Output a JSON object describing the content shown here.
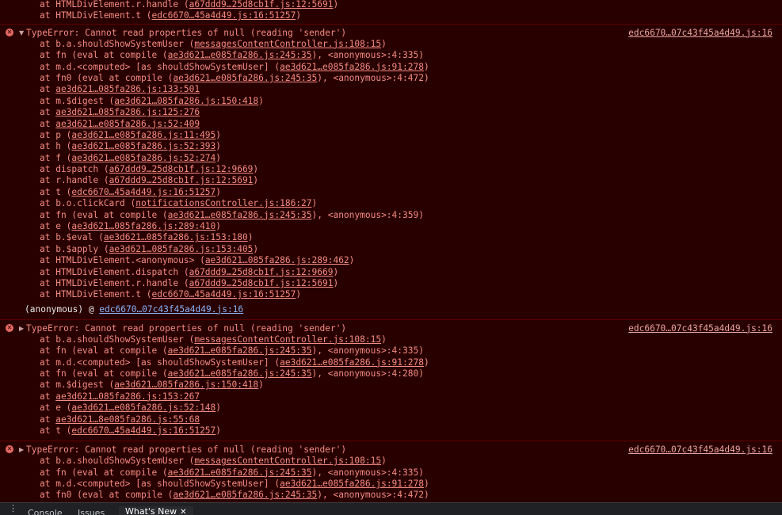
{
  "groups": [
    {
      "partial": true,
      "frames": [
        {
          "pre": "at HTMLDivElement.r.handle (",
          "loc": "a67ddd9…25d8cb1f.js:12:5691",
          "post": ")"
        },
        {
          "pre": "at HTMLDivElement.t (",
          "loc": "edc6670…45a4d49.js:16:51257",
          "post": ")"
        }
      ]
    },
    {
      "icon": "✕",
      "expanded": true,
      "toggle": "▼",
      "message": "TypeError: Cannot read properties of null (reading 'sender')",
      "source": "edc6670…07c43f45a4d49.js:16",
      "frames": [
        {
          "pre": "at b.a.shouldShowSystemUser (",
          "loc": "messagesContentController.js:108:15",
          "post": ")"
        },
        {
          "pre": "at fn (eval at compile (",
          "loc": "ae3d621…e085fa286.js:245:35",
          "post": "), <anonymous>:4:335)"
        },
        {
          "pre": "at m.d.<computed> [as shouldShowSystemUser] (",
          "loc": "ae3d621…e085fa286.js:91:278",
          "post": ")"
        },
        {
          "pre": "at fn0 (eval at compile (",
          "loc": "ae3d621…e085fa286.js:245:35",
          "post": "), <anonymous>:4:472)"
        },
        {
          "pre": "at ",
          "loc": "ae3d621…085fa286.js:133:501",
          "post": ""
        },
        {
          "pre": "at m.$digest (",
          "loc": "ae3d621…085fa286.js:150:418",
          "post": ")"
        },
        {
          "pre": "at ",
          "loc": "ae3d621…085fa286.js:125:276",
          "post": ""
        },
        {
          "pre": "at ",
          "loc": "ae3d621…e085fa286.js:52:409",
          "post": ""
        },
        {
          "pre": "at p (",
          "loc": "ae3d621…e085fa286.js:11:495",
          "post": ")"
        },
        {
          "pre": "at h (",
          "loc": "ae3d621…e085fa286.js:52:393",
          "post": ")"
        },
        {
          "pre": "at f (",
          "loc": "ae3d621…e085fa286.js:52:274",
          "post": ")"
        },
        {
          "pre": "at dispatch (",
          "loc": "a67ddd9…25d8cb1f.js:12:9669",
          "post": ")"
        },
        {
          "pre": "at r.handle (",
          "loc": "a67ddd9…25d8cb1f.js:12:5691",
          "post": ")"
        },
        {
          "pre": "at t (",
          "loc": "edc6670…45a4d49.js:16:51257",
          "post": ")"
        },
        {
          "pre": "at b.o.clickCard (",
          "loc": "notificationsController.js:186:27",
          "post": ")"
        },
        {
          "pre": "at fn (eval at compile (",
          "loc": "ae3d621…e085fa286.js:245:35",
          "post": "), <anonymous>:4:359)"
        },
        {
          "pre": "at e (",
          "loc": "ae3d621…085fa286.js:289:410",
          "post": ")"
        },
        {
          "pre": "at b.$eval (",
          "loc": "ae3d621…085fa286.js:153:180",
          "post": ")"
        },
        {
          "pre": "at b.$apply (",
          "loc": "ae3d621…085fa286.js:153:405",
          "post": ")"
        },
        {
          "pre": "at HTMLDivElement.<anonymous> (",
          "loc": "ae3d621…085fa286.js:289:462",
          "post": ")"
        },
        {
          "pre": "at HTMLDivElement.dispatch (",
          "loc": "a67ddd9…25d8cb1f.js:12:9669",
          "post": ")"
        },
        {
          "pre": "at HTMLDivElement.r.handle (",
          "loc": "a67ddd9…25d8cb1f.js:12:5691",
          "post": ")"
        },
        {
          "pre": "at HTMLDivElement.t (",
          "loc": "edc6670…45a4d49.js:16:51257",
          "post": ")"
        }
      ],
      "anon": {
        "pre": "(anonymous) @ ",
        "loc": "edc6670…07c43f45a4d49.js:16"
      }
    },
    {
      "icon": "✕",
      "expanded": false,
      "toggle": "▶",
      "message": "TypeError: Cannot read properties of null (reading 'sender')",
      "source": "edc6670…07c43f45a4d49.js:16",
      "frames": [
        {
          "pre": "at b.a.shouldShowSystemUser (",
          "loc": "messagesContentController.js:108:15",
          "post": ")"
        },
        {
          "pre": "at fn (eval at compile (",
          "loc": "ae3d621…e085fa286.js:245:35",
          "post": "), <anonymous>:4:335)"
        },
        {
          "pre": "at m.d.<computed> [as shouldShowSystemUser] (",
          "loc": "ae3d621…e085fa286.js:91:278",
          "post": ")"
        },
        {
          "pre": "at fn (eval at compile (",
          "loc": "ae3d621…e085fa286.js:245:35",
          "post": "), <anonymous>:4:280)"
        },
        {
          "pre": "at m.$digest (",
          "loc": "ae3d621…085fa286.js:150:418",
          "post": ")"
        },
        {
          "pre": "at ",
          "loc": "ae3d621…085fa286.js:153:267",
          "post": ""
        },
        {
          "pre": "at e (",
          "loc": "ae3d621…e085fa286.js:52:148",
          "post": ")"
        },
        {
          "pre": "at ",
          "loc": "ae3d621…8e085fa286.js:55:68",
          "post": ""
        },
        {
          "pre": "at t (",
          "loc": "edc6670…45a4d49.js:16:51257",
          "post": ")"
        }
      ]
    },
    {
      "icon": "✕",
      "expanded": false,
      "toggle": "▶",
      "message": "TypeError: Cannot read properties of null (reading 'sender')",
      "source": "edc6670…07c43f45a4d49.js:16",
      "frames": [
        {
          "pre": "at b.a.shouldShowSystemUser (",
          "loc": "messagesContentController.js:108:15",
          "post": ")"
        },
        {
          "pre": "at fn (eval at compile (",
          "loc": "ae3d621…e085fa286.js:245:35",
          "post": "), <anonymous>:4:335)"
        },
        {
          "pre": "at m.d.<computed> [as shouldShowSystemUser] (",
          "loc": "ae3d621…e085fa286.js:91:278",
          "post": ")"
        },
        {
          "pre": "at fn0 (eval at compile (",
          "loc": "ae3d621…e085fa286.js:245:35",
          "post": "), <anonymous>:4:472)"
        }
      ]
    }
  ],
  "drawer": {
    "menu_icon": "⋮",
    "tabs": [
      {
        "label": "Console",
        "active": false
      },
      {
        "label": "Issues",
        "active": false
      },
      {
        "label": "What's New",
        "active": true,
        "close": "✕"
      }
    ]
  }
}
